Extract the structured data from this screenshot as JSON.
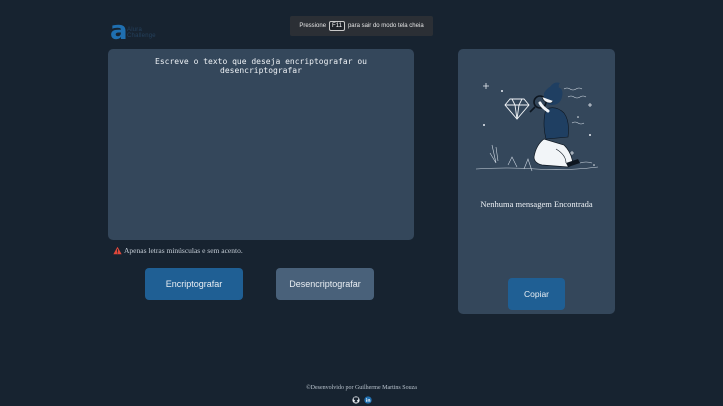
{
  "header": {
    "logo_letter": "a",
    "logo_text": "Alura Challenge"
  },
  "fullscreen_banner": {
    "prefix": "Pressione",
    "key": "F11",
    "suffix": "para sair do modo tela cheia"
  },
  "main": {
    "input_placeholder": "Escreve o texto que deseja encriptografar ou desencriptografar",
    "input_value": "",
    "warning_text": "Apenas letras minúsculas e sem acento.",
    "encrypt_label": "Encriptografar",
    "decrypt_label": "Desencriptografar"
  },
  "side_panel": {
    "message": "Nenhuma mensagem Encontrada",
    "copy_label": "Copiar"
  },
  "footer": {
    "credit": "©Desenvolvido por Guilherme Martins Souza",
    "icons": [
      "github-icon",
      "linkedin-icon"
    ]
  },
  "colors": {
    "background": "#172330",
    "panel": "#34475b",
    "primary_button": "#1f5f94",
    "secondary_button": "#49617a",
    "warning": "#e0473a"
  }
}
